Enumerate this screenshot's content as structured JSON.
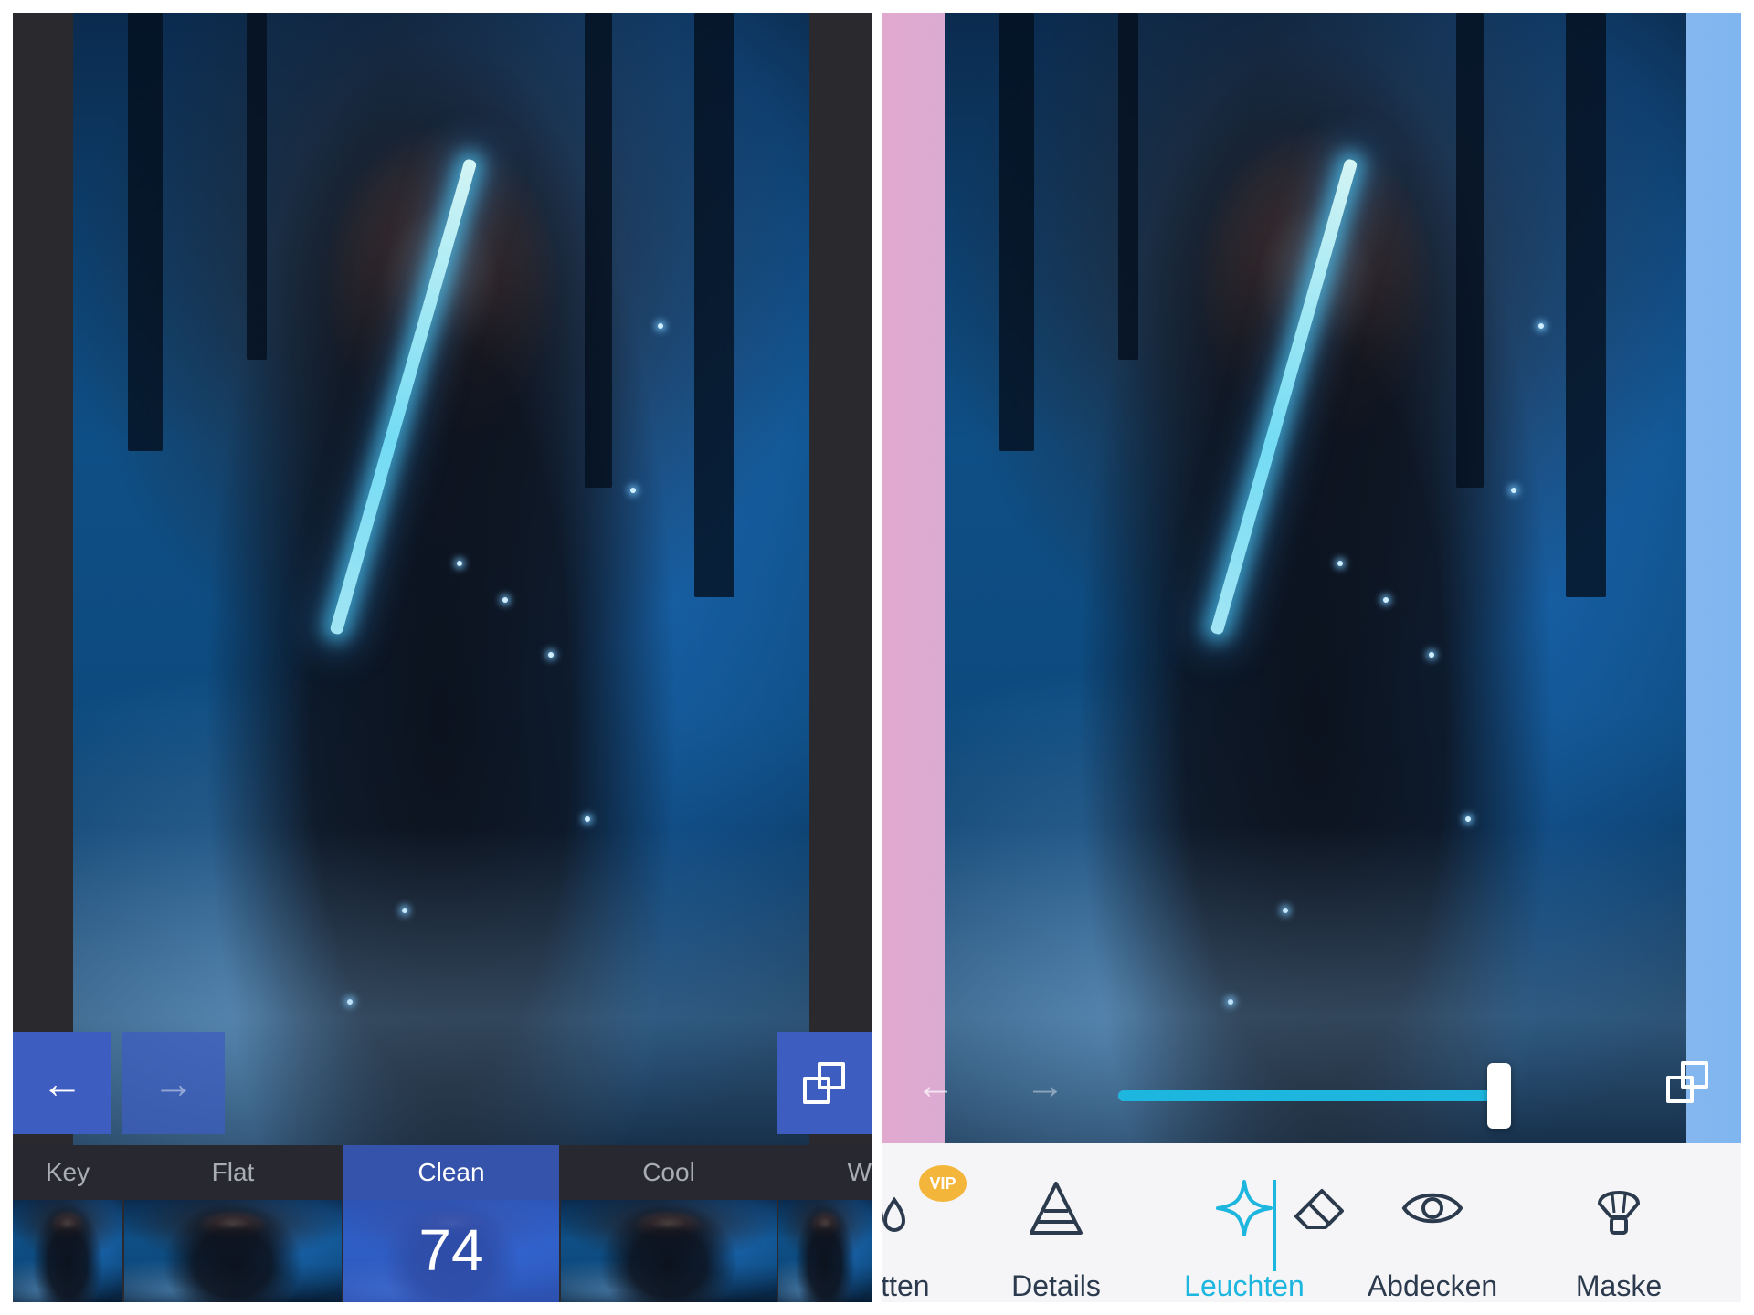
{
  "left": {
    "undo_icon": "←",
    "redo_icon": "→",
    "compare_icon": "compare-icon",
    "filters": [
      {
        "name": "Key",
        "active": false
      },
      {
        "name": "Flat",
        "active": false
      },
      {
        "name": "Clean",
        "active": true,
        "value": "74"
      },
      {
        "name": "Cool",
        "active": false
      },
      {
        "name": "W",
        "active": false
      }
    ],
    "colors": {
      "accent": "#3d5dc0",
      "panel": "#2a2a2e"
    }
  },
  "right": {
    "undo_icon": "←",
    "redo_icon": "→",
    "slider_value": 1.0,
    "vip_badge": "VIP",
    "tools": [
      {
        "name": "smooth",
        "label": "Glätten",
        "icon": "drops-icon",
        "vip": true
      },
      {
        "name": "details",
        "label": "Details",
        "icon": "triangle-icon"
      },
      {
        "name": "glow",
        "label": "Leuchten",
        "icon": "sparkle-icon",
        "active": true
      },
      {
        "name": "erase",
        "label": "",
        "icon": "eraser-icon"
      },
      {
        "name": "cover",
        "label": "Abdecken",
        "icon": "eye-icon"
      },
      {
        "name": "mask",
        "label": "Maske",
        "icon": "brush-icon"
      }
    ],
    "colors": {
      "accent": "#1db6df",
      "text": "#2b3a4d"
    }
  }
}
